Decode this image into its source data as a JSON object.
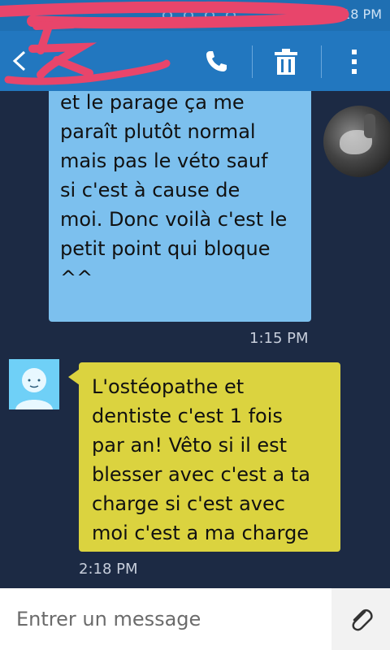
{
  "status_bar": {
    "time": "1:18 PM"
  },
  "header": {
    "back_icon": "chevron-left-icon",
    "actions": [
      {
        "icon": "phone-icon"
      },
      {
        "icon": "trash-icon"
      },
      {
        "icon": "more-vertical-icon"
      }
    ]
  },
  "conversation": {
    "messages": [
      {
        "direction": "outgoing",
        "lines": [
          "et le parage ça me",
          "paraît plutôt normal",
          "mais pas le véto sauf",
          "si c'est à cause de",
          "moi. Donc voilà c'est le",
          "petit point qui bloque",
          "^^"
        ],
        "time": "1:15 PM"
      },
      {
        "direction": "incoming",
        "lines": [
          "L'ostéopathe et",
          "dentiste c'est 1 fois",
          "par an! Vêto si il est",
          "blesser avec c'est a ta",
          "charge si c'est avec",
          "moi c'est a ma charge"
        ],
        "time": "2:18 PM"
      }
    ]
  },
  "composer": {
    "placeholder": "Entrer un message",
    "attach_icon": "paperclip-icon"
  },
  "colors": {
    "header": "#2277bf",
    "background": "#1c2a44",
    "outgoing_bubble": "#7cc0ee",
    "incoming_bubble": "#dbd33f"
  }
}
